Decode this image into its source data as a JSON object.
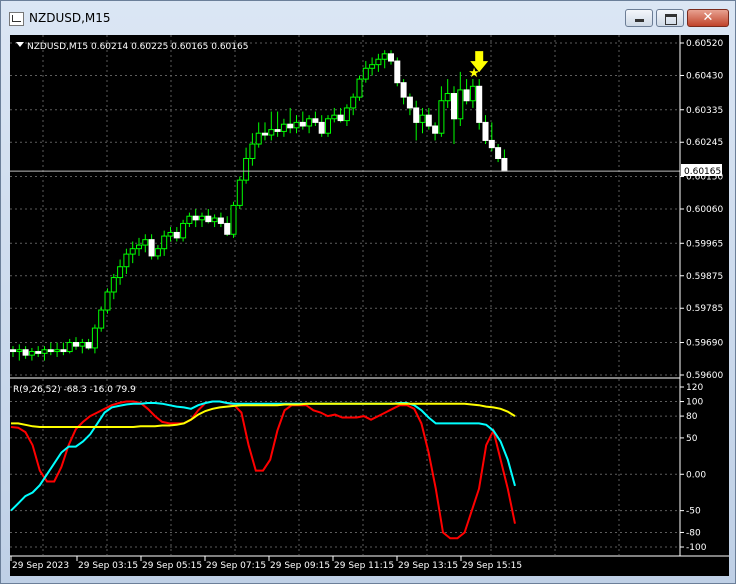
{
  "window": {
    "title": "NZDUSD,M15",
    "close_glyph": "✕"
  },
  "chart_info": {
    "header": "NZDUSD,M15  0.60214 0.60225 0.60165 0.60165"
  },
  "indicator": {
    "header": "R(9,26,52) -68.3 -16.0 79.9"
  },
  "current_price_label": "0.60165",
  "colors": {
    "background": "#000000",
    "grid": "#5d5d5d",
    "axis": "#ffffff",
    "bull_candle": "#00ff00",
    "bear_candle": "#ffffff",
    "line_red": "#ff0000",
    "line_cyan": "#00ffff",
    "line_yellow": "#ffff00",
    "arrow": "#ffff00"
  },
  "icons": {
    "menu": "triangle-down-icon",
    "signal": "arrow-down-icon",
    "star": "star-icon"
  },
  "chart_data": [
    {
      "type": "candlestick",
      "title": "NZDUSD,M15",
      "ylim": [
        0.596,
        0.6052
      ],
      "y_ticks": [
        "0.60520",
        "0.60430",
        "0.60335",
        "0.60245",
        "0.60150",
        "0.60060",
        "0.59965",
        "0.59875",
        "0.59785",
        "0.59690",
        "0.59600"
      ],
      "ohlc": [
        [
          0.5967,
          0.5968,
          0.5965,
          0.59665
        ],
        [
          0.59665,
          0.59685,
          0.5964,
          0.5967
        ],
        [
          0.5967,
          0.5968,
          0.59645,
          0.59655
        ],
        [
          0.59655,
          0.59675,
          0.5964,
          0.59665
        ],
        [
          0.59665,
          0.5968,
          0.5965,
          0.5966
        ],
        [
          0.5966,
          0.5968,
          0.5964,
          0.5967
        ],
        [
          0.5967,
          0.5969,
          0.59655,
          0.59665
        ],
        [
          0.59665,
          0.5969,
          0.5965,
          0.5967
        ],
        [
          0.5967,
          0.5969,
          0.59655,
          0.59665
        ],
        [
          0.59665,
          0.597,
          0.5966,
          0.5969
        ],
        [
          0.5969,
          0.59705,
          0.5967,
          0.5968
        ],
        [
          0.5968,
          0.597,
          0.5966,
          0.5969
        ],
        [
          0.5969,
          0.597,
          0.5967,
          0.59675
        ],
        [
          0.59675,
          0.5974,
          0.5966,
          0.5973
        ],
        [
          0.5973,
          0.5979,
          0.5972,
          0.5978
        ],
        [
          0.5978,
          0.5984,
          0.5977,
          0.5983
        ],
        [
          0.5983,
          0.5988,
          0.5981,
          0.5987
        ],
        [
          0.5987,
          0.5992,
          0.5985,
          0.599
        ],
        [
          0.599,
          0.5995,
          0.5988,
          0.59935
        ],
        [
          0.59935,
          0.5997,
          0.5991,
          0.5995
        ],
        [
          0.5995,
          0.5998,
          0.5993,
          0.5996
        ],
        [
          0.5996,
          0.5999,
          0.5994,
          0.59975
        ],
        [
          0.59975,
          0.5999,
          0.5992,
          0.5993
        ],
        [
          0.5993,
          0.5996,
          0.5992,
          0.5995
        ],
        [
          0.5995,
          0.6,
          0.5993,
          0.59985
        ],
        [
          0.59985,
          0.6001,
          0.5997,
          0.59995
        ],
        [
          0.59995,
          0.6001,
          0.5997,
          0.5998
        ],
        [
          0.5998,
          0.6003,
          0.5997,
          0.6002
        ],
        [
          0.6002,
          0.6005,
          0.6001,
          0.6004
        ],
        [
          0.6004,
          0.6006,
          0.6001,
          0.6003
        ],
        [
          0.6003,
          0.6005,
          0.6001,
          0.6004
        ],
        [
          0.6004,
          0.6006,
          0.6002,
          0.60025
        ],
        [
          0.60025,
          0.60045,
          0.6001,
          0.60035
        ],
        [
          0.60035,
          0.6005,
          0.6001,
          0.6002
        ],
        [
          0.6002,
          0.6004,
          0.59985,
          0.5999
        ],
        [
          0.5999,
          0.6008,
          0.5998,
          0.6007
        ],
        [
          0.6007,
          0.6015,
          0.6006,
          0.6014
        ],
        [
          0.6014,
          0.6023,
          0.6013,
          0.602
        ],
        [
          0.602,
          0.6027,
          0.6018,
          0.6024
        ],
        [
          0.6024,
          0.603,
          0.6023,
          0.6027
        ],
        [
          0.6027,
          0.603,
          0.6025,
          0.60265
        ],
        [
          0.60265,
          0.6033,
          0.6025,
          0.6028
        ],
        [
          0.6028,
          0.6033,
          0.6026,
          0.60275
        ],
        [
          0.60275,
          0.6031,
          0.6026,
          0.60295
        ],
        [
          0.60295,
          0.6034,
          0.6027,
          0.60285
        ],
        [
          0.60285,
          0.6032,
          0.6027,
          0.603
        ],
        [
          0.603,
          0.6033,
          0.6028,
          0.6029
        ],
        [
          0.6029,
          0.6032,
          0.6027,
          0.6031
        ],
        [
          0.6031,
          0.6033,
          0.6029,
          0.603
        ],
        [
          0.603,
          0.6032,
          0.6026,
          0.6027
        ],
        [
          0.6027,
          0.6032,
          0.6026,
          0.6031
        ],
        [
          0.6031,
          0.6034,
          0.603,
          0.6032
        ],
        [
          0.6032,
          0.6034,
          0.603,
          0.60305
        ],
        [
          0.60305,
          0.6035,
          0.6029,
          0.6034
        ],
        [
          0.6034,
          0.6038,
          0.6032,
          0.6037
        ],
        [
          0.6037,
          0.6043,
          0.6036,
          0.6042
        ],
        [
          0.6042,
          0.6047,
          0.6041,
          0.6045
        ],
        [
          0.6045,
          0.6048,
          0.6043,
          0.6046
        ],
        [
          0.6046,
          0.6049,
          0.6044,
          0.60475
        ],
        [
          0.60475,
          0.605,
          0.6045,
          0.6049
        ],
        [
          0.6049,
          0.605,
          0.6046,
          0.6047
        ],
        [
          0.6047,
          0.6048,
          0.604,
          0.6041
        ],
        [
          0.6041,
          0.6042,
          0.6035,
          0.6037
        ],
        [
          0.6037,
          0.6038,
          0.6032,
          0.6034
        ],
        [
          0.6034,
          0.6036,
          0.6025,
          0.603
        ],
        [
          0.603,
          0.6034,
          0.6027,
          0.6032
        ],
        [
          0.6032,
          0.6034,
          0.6028,
          0.6029
        ],
        [
          0.6029,
          0.603,
          0.6025,
          0.6027
        ],
        [
          0.6027,
          0.604,
          0.6026,
          0.6036
        ],
        [
          0.6036,
          0.6042,
          0.6034,
          0.6038
        ],
        [
          0.6038,
          0.604,
          0.6024,
          0.6031
        ],
        [
          0.6031,
          0.6044,
          0.6029,
          0.6039
        ],
        [
          0.6039,
          0.6042,
          0.6035,
          0.6036
        ],
        [
          0.6036,
          0.6042,
          0.6034,
          0.604
        ],
        [
          0.604,
          0.6042,
          0.6028,
          0.603
        ],
        [
          0.603,
          0.6032,
          0.6024,
          0.6025
        ],
        [
          0.6025,
          0.603,
          0.6022,
          0.6023
        ],
        [
          0.6023,
          0.6024,
          0.6019,
          0.602
        ],
        [
          0.602,
          0.60225,
          0.60165,
          0.60165
        ]
      ],
      "current_price": 0.60165,
      "signal_arrow_at": 74
    },
    {
      "type": "line",
      "title": "R(9,26,52) -68.3 -16.0 79.9",
      "ylim": [
        -100,
        120
      ],
      "y_ticks": [
        "120",
        "100",
        "80",
        "50",
        "0.00",
        "-50",
        "-80",
        "-100"
      ],
      "x_tick_labels": [
        "29 Sep 2023",
        "29 Sep 03:15",
        "29 Sep 05:15",
        "29 Sep 07:15",
        "29 Sep 09:15",
        "29 Sep 11:15",
        "29 Sep 13:15",
        "29 Sep 15:15"
      ],
      "series": [
        {
          "values": [
            65,
            64,
            58,
            40,
            5,
            -10,
            -10,
            10,
            40,
            62,
            72,
            80,
            85,
            90,
            95,
            98,
            100,
            100,
            98,
            90,
            80,
            72,
            70,
            70,
            70,
            75,
            88,
            98,
            100,
            100,
            98,
            95,
            85,
            40,
            5,
            5,
            20,
            60,
            88,
            95,
            95,
            95,
            88,
            85,
            80,
            82,
            78,
            78,
            78,
            80,
            75,
            80,
            85,
            90,
            95,
            95,
            90,
            70,
            30,
            -20,
            -80,
            -88,
            -88,
            -80,
            -50,
            -20,
            40,
            60,
            20,
            -20,
            -68
          ]
        },
        {
          "values": [
            -50,
            -40,
            -30,
            -25,
            -15,
            0,
            15,
            30,
            38,
            38,
            45,
            55,
            70,
            85,
            92,
            94,
            96,
            97,
            97,
            98,
            98,
            97,
            95,
            93,
            92,
            90,
            95,
            98,
            100,
            100,
            98,
            97,
            97,
            97,
            97,
            97,
            97,
            97,
            97,
            97,
            97,
            97,
            97,
            97,
            97,
            97,
            97,
            97,
            97,
            97,
            97,
            97,
            97,
            97,
            98,
            98,
            95,
            88,
            78,
            70,
            70,
            70,
            70,
            70,
            70,
            70,
            68,
            60,
            45,
            20,
            -16
          ]
        },
        {
          "values": [
            70,
            70,
            68,
            66,
            65,
            65,
            65,
            65,
            65,
            65,
            65,
            65,
            65,
            65,
            65,
            65,
            65,
            65,
            66,
            66,
            66,
            67,
            67,
            68,
            70,
            75,
            82,
            87,
            90,
            92,
            93,
            94,
            95,
            95,
            95,
            95,
            95,
            95,
            96,
            96,
            96,
            97,
            97,
            97,
            97,
            97,
            97,
            97,
            97,
            97,
            97,
            97,
            97,
            97,
            97,
            97,
            97,
            97,
            97,
            97,
            97,
            97,
            97,
            97,
            96,
            95,
            93,
            92,
            90,
            86,
            80
          ]
        }
      ]
    }
  ]
}
